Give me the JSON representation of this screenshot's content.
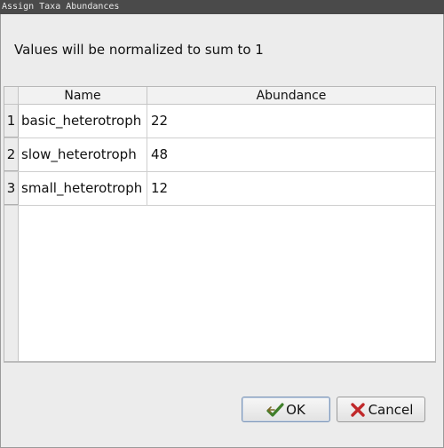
{
  "window": {
    "title": "Assign Taxa Abundances"
  },
  "info": {
    "text": "Values will be normalized to sum to 1"
  },
  "table": {
    "columns": [
      "Name",
      "Abundance"
    ],
    "rows": [
      {
        "index": "1",
        "name": "basic_heterotroph",
        "abundance": "22"
      },
      {
        "index": "2",
        "name": "slow_heterotroph",
        "abundance": "48"
      },
      {
        "index": "3",
        "name": "small_heterotroph",
        "abundance": "12"
      }
    ]
  },
  "buttons": {
    "ok": {
      "label": "OK",
      "icon": "check-arrow-icon"
    },
    "cancel": {
      "label": "Cancel",
      "icon": "x-mark-icon"
    }
  }
}
